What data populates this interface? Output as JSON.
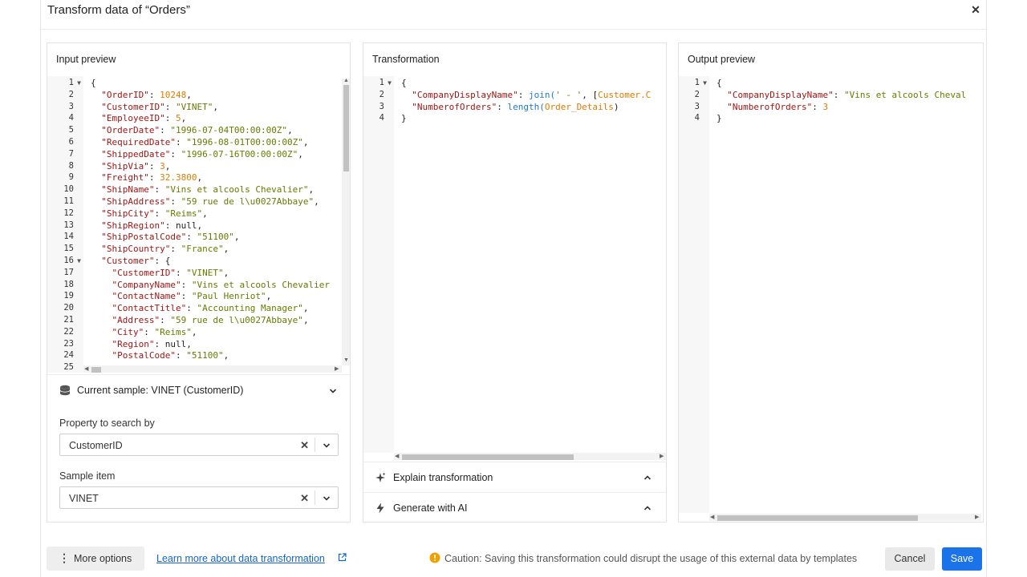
{
  "modal": {
    "title": "Transform data of “Orders”"
  },
  "input_panel": {
    "title": "Input preview",
    "lines": [
      {
        "n": "1",
        "fold": true,
        "html": "{"
      },
      {
        "n": "2",
        "html": "  <span class='k'>\"OrderID\"</span>: <span class='n'>10248</span>,"
      },
      {
        "n": "3",
        "html": "  <span class='k'>\"CustomerID\"</span>: <span class='s'>\"VINET\"</span>,"
      },
      {
        "n": "4",
        "html": "  <span class='k'>\"EmployeeID\"</span>: <span class='n'>5</span>,"
      },
      {
        "n": "5",
        "html": "  <span class='k'>\"OrderDate\"</span>: <span class='s'>\"1996-07-04T00:00:00Z\"</span>,"
      },
      {
        "n": "6",
        "html": "  <span class='k'>\"RequiredDate\"</span>: <span class='s'>\"1996-08-01T00:00:00Z\"</span>,"
      },
      {
        "n": "7",
        "html": "  <span class='k'>\"ShippedDate\"</span>: <span class='s'>\"1996-07-16T00:00:00Z\"</span>,"
      },
      {
        "n": "8",
        "html": "  <span class='k'>\"ShipVia\"</span>: <span class='n'>3</span>,"
      },
      {
        "n": "9",
        "html": "  <span class='k'>\"Freight\"</span>: <span class='n'>32.3800</span>,"
      },
      {
        "n": "10",
        "html": "  <span class='k'>\"ShipName\"</span>: <span class='s'>\"Vins et alcools Chevalier\"</span>,"
      },
      {
        "n": "11",
        "html": "  <span class='k'>\"ShipAddress\"</span>: <span class='s'>\"59 rue de l\\u0027Abbaye\"</span>,"
      },
      {
        "n": "12",
        "html": "  <span class='k'>\"ShipCity\"</span>: <span class='s'>\"Reims\"</span>,"
      },
      {
        "n": "13",
        "html": "  <span class='k'>\"ShipRegion\"</span>: null,"
      },
      {
        "n": "14",
        "html": "  <span class='k'>\"ShipPostalCode\"</span>: <span class='s'>\"51100\"</span>,"
      },
      {
        "n": "15",
        "html": "  <span class='k'>\"ShipCountry\"</span>: <span class='s'>\"France\"</span>,"
      },
      {
        "n": "16",
        "fold": true,
        "html": "  <span class='k'>\"Customer\"</span>: {"
      },
      {
        "n": "17",
        "html": "    <span class='k'>\"CustomerID\"</span>: <span class='s'>\"VINET\"</span>,"
      },
      {
        "n": "18",
        "html": "    <span class='k'>\"CompanyName\"</span>: <span class='s'>\"Vins et alcools Chevalier</span>"
      },
      {
        "n": "19",
        "html": "    <span class='k'>\"ContactName\"</span>: <span class='s'>\"Paul Henriot\"</span>,"
      },
      {
        "n": "20",
        "html": "    <span class='k'>\"ContactTitle\"</span>: <span class='s'>\"Accounting Manager\"</span>,"
      },
      {
        "n": "21",
        "html": "    <span class='k'>\"Address\"</span>: <span class='s'>\"59 rue de l\\u0027Abbaye\"</span>,"
      },
      {
        "n": "22",
        "html": "    <span class='k'>\"City\"</span>: <span class='s'>\"Reims\"</span>,"
      },
      {
        "n": "23",
        "html": "    <span class='k'>\"Region\"</span>: null,"
      },
      {
        "n": "24",
        "html": "    <span class='k'>\"PostalCode\"</span>: <span class='s'>\"51100\"</span>,"
      },
      {
        "n": "25",
        "html": ""
      }
    ],
    "sample": "Current sample: VINET (CustomerID)",
    "property_label": "Property to search by",
    "property_value": "CustomerID",
    "sample_item_label": "Sample item",
    "sample_item_value": "VINET"
  },
  "transform_panel": {
    "title": "Transformation",
    "lines": [
      {
        "n": "1",
        "fold": true,
        "html": "{"
      },
      {
        "n": "2",
        "html": "  <span class='k'>\"CompanyDisplayName\"</span>: <span class='f'>join(</span><span class='s'>' - '</span>, [<span class='n'>Customer.C</span>"
      },
      {
        "n": "3",
        "html": "  <span class='k'>\"NumberofOrders\"</span>: <span class='f'>length(</span><span class='n'>Order_Details</span>)"
      },
      {
        "n": "4",
        "html": "}"
      }
    ],
    "explain": "Explain transformation",
    "generate": "Generate with AI"
  },
  "output_panel": {
    "title": "Output preview",
    "lines": [
      {
        "n": "1",
        "fold": true,
        "html": "{"
      },
      {
        "n": "2",
        "html": "  <span class='k'>\"CompanyDisplayName\"</span>: <span class='s'>\"Vins et alcools Cheval</span>"
      },
      {
        "n": "3",
        "html": "  <span class='k'>\"NumberofOrders\"</span>: <span class='n'>3</span>"
      },
      {
        "n": "4",
        "html": "}"
      }
    ]
  },
  "footer": {
    "more_options": "More options",
    "learn_more": "Learn more about data transformation",
    "caution": "Caution: Saving this transformation could disrupt the usage of this external data by templates",
    "cancel": "Cancel",
    "save": "Save"
  },
  "colors": {
    "accent": "#1a73e8",
    "warning": "#f0a000",
    "link": "#1565c0"
  }
}
